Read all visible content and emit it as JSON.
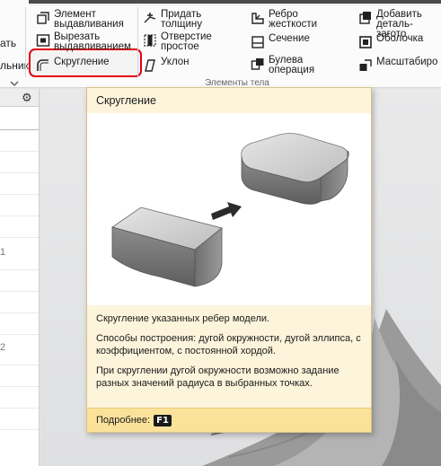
{
  "ribbon": {
    "left_cut_1": "ать",
    "left_cut_2": "льник",
    "buttons": {
      "element_extrude": "Элемент\nвыдавливания",
      "cut_extrude": "Вырезать\nвыдавливанием",
      "fillet": "Скругление",
      "thicken": "Придать\nтолщину",
      "hole_simple": "Отверстие\nпростое",
      "draft": "Уклон",
      "rib": "Ребро\nжесткости",
      "section": "Сечение",
      "boolean": "Булева\nоперация",
      "add_blank": "Добавить\nдеталь-загото",
      "shell": "Оболочка",
      "scale": "Масштабиро"
    },
    "group_label": "Элементы тела"
  },
  "tree": {
    "row_labels": [
      "",
      "",
      "",
      "",
      "",
      "",
      "1",
      "",
      "",
      "",
      "2",
      "",
      "",
      "",
      ""
    ]
  },
  "tooltip": {
    "title": "Скругление",
    "desc1": "Скругление указанных ребер модели.",
    "desc2": "Способы построения: дугой окружности, дугой эллипса, с коэффициентом, с постоянной хордой.",
    "desc3": "При скруглении дугой окружности возможно задание разных значений радиуса в выбранных точках.",
    "more": "Подробнее:",
    "key": "F1"
  },
  "icons": [
    "extrude-icon",
    "cut-extrude-icon",
    "fillet-icon",
    "thicken-icon",
    "hole-icon",
    "draft-icon",
    "rib-icon",
    "section-icon",
    "boolean-icon",
    "add-blank-icon",
    "shell-icon",
    "scale-icon",
    "settings-gear-icon",
    "arrow-right-icon"
  ],
  "colors": {
    "highlight": "#e3000f",
    "tooltip_bg": "#fdf4dc",
    "tooltip_footer": "#fae29b"
  }
}
